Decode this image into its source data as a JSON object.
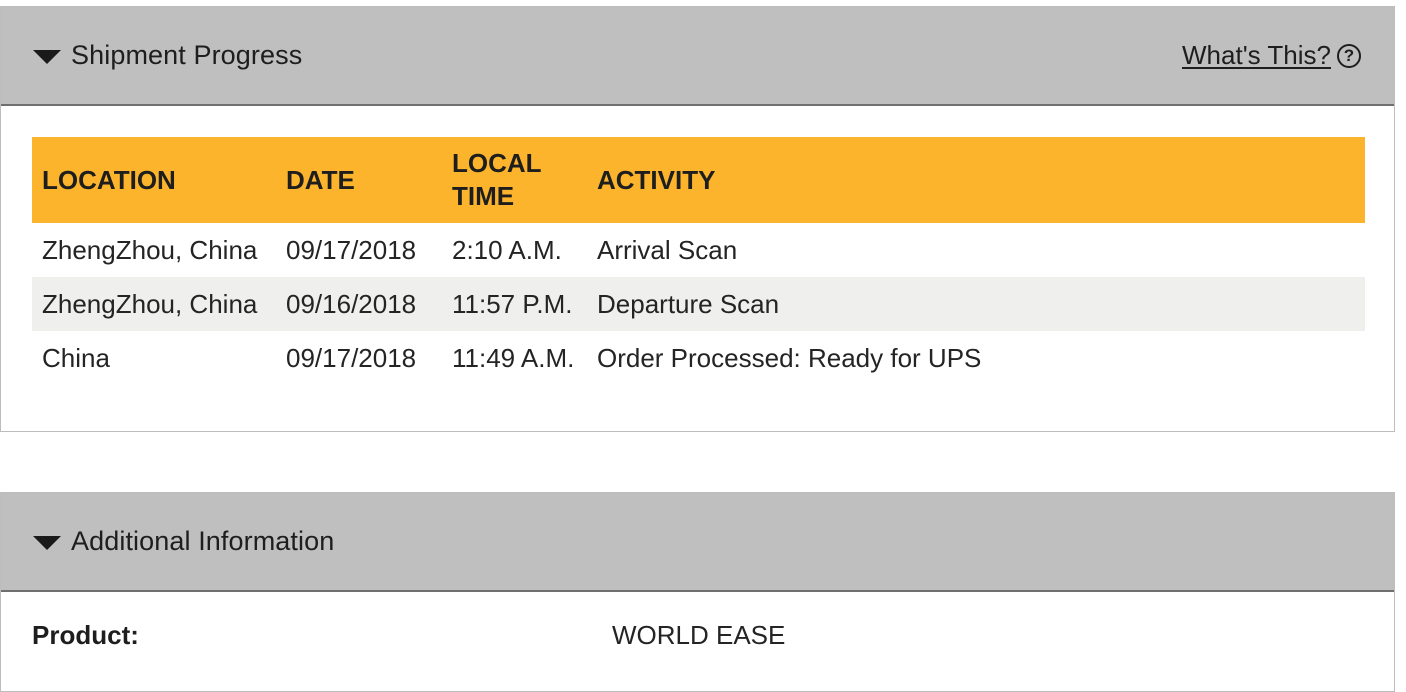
{
  "shipment_progress": {
    "title": "Shipment Progress",
    "help_link": "What's This?",
    "help_icon": "?",
    "columns": [
      "LOCATION",
      "DATE",
      "LOCAL TIME",
      "ACTIVITY"
    ],
    "rows": [
      {
        "location": "ZhengZhou,  China",
        "date": "09/17/2018",
        "time": "2:10 A.M.",
        "activity": "Arrival Scan"
      },
      {
        "location": "ZhengZhou,  China",
        "date": "09/16/2018",
        "time": "11:57 P.M.",
        "activity": "Departure Scan"
      },
      {
        "location": "China",
        "date": "09/17/2018",
        "time": "11:49 A.M.",
        "activity": "Order Processed: Ready for UPS"
      }
    ],
    "header_color": "#fbb42b"
  },
  "additional_information": {
    "title": "Additional Information",
    "product_label": "Product:",
    "product_value": "WORLD EASE"
  }
}
